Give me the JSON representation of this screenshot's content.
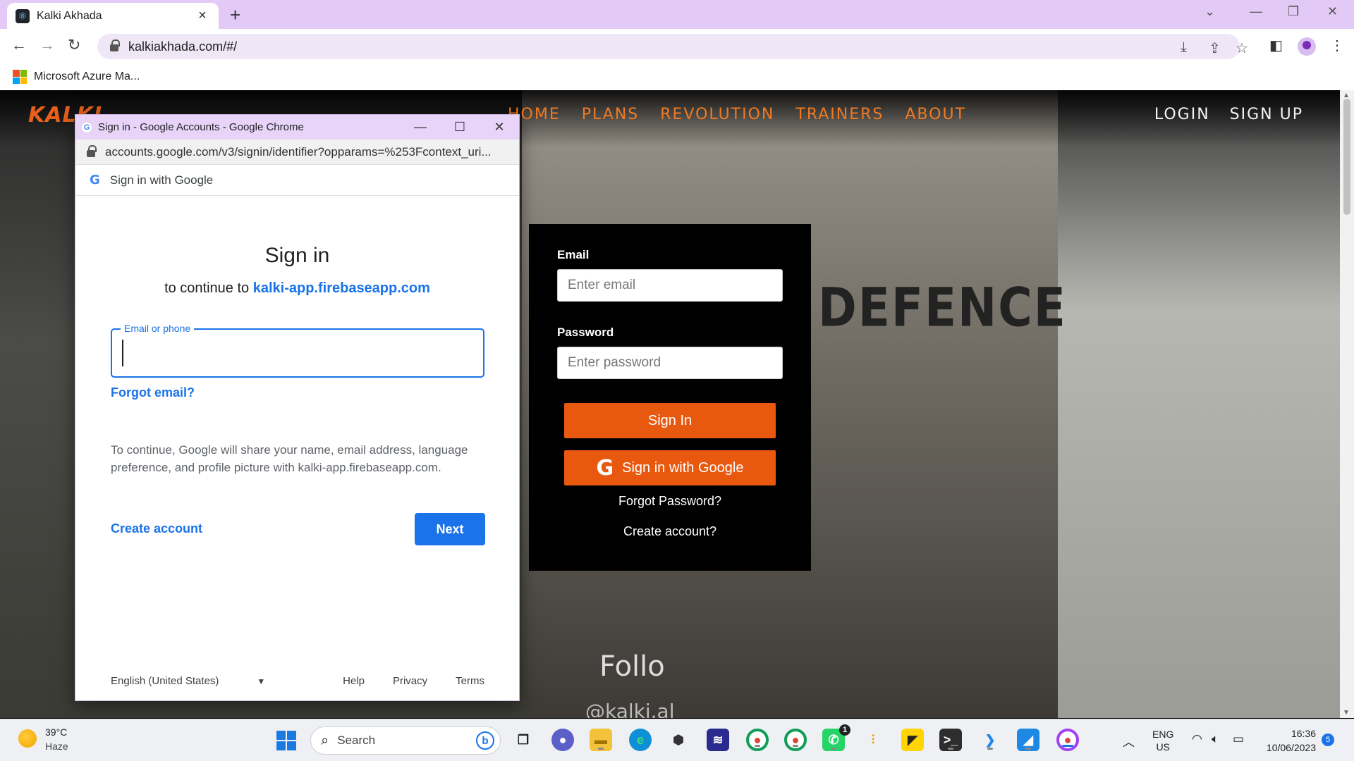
{
  "browser": {
    "tab_title": "Kalki Akhada",
    "url": "kalkiakhada.com/#/",
    "bookmark": "Microsoft Azure Ma..."
  },
  "site": {
    "logo": "KALKI",
    "nav": [
      "HOME",
      "PLANS",
      "REVOLUTION",
      "TRAINERS",
      "ABOUT"
    ],
    "auth": [
      "LOGIN",
      "SIGN UP"
    ],
    "background_text": {
      "defence": "DEFENCE",
      "follow": "Follo",
      "handle": "@kalki.al"
    }
  },
  "login_form": {
    "email_label": "Email",
    "email_placeholder": "Enter email",
    "password_label": "Password",
    "password_placeholder": "Enter password",
    "signin_button": "Sign In",
    "google_button": "Sign in with Google",
    "forgot_password": "Forgot Password?",
    "create_account": "Create account?"
  },
  "popup": {
    "window_title": "Sign in - Google Accounts - Google Chrome",
    "url": "accounts.google.com/v3/signin/identifier?opparams=%253Fcontext_uri...",
    "header": "Sign in with Google",
    "title": "Sign in",
    "continue_prefix": "to continue to ",
    "continue_domain": "kalki-app.firebaseapp.com",
    "email_label": "Email or phone",
    "forgot_email": "Forgot email?",
    "disclaimer": "To continue, Google will share your name, email address, language preference, and profile picture with kalki-app.firebaseapp.com.",
    "create_account": "Create account",
    "next": "Next",
    "language": "English (United States)",
    "footer_links": [
      "Help",
      "Privacy",
      "Terms"
    ]
  },
  "taskbar": {
    "temperature": "39°C",
    "weather": "Haze",
    "search": "Search",
    "lang_top": "ENG",
    "lang_bottom": "US",
    "time": "16:36",
    "date": "10/06/2023",
    "notifications": "5",
    "whatsapp_badge": "1"
  },
  "colors": {
    "accent_orange": "#e8580f",
    "google_blue": "#1a73e8",
    "tab_strip": "#e3c9f5"
  }
}
